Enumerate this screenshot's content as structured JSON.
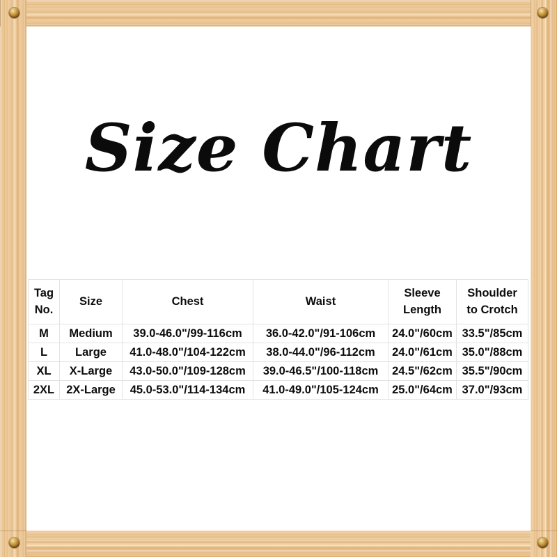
{
  "document": {
    "title": "Size Chart",
    "frame": {
      "material_name": "wooden-plank-frame",
      "wood_color": "#e9c18f",
      "wood_shadow_color": "#dcae76",
      "screw_color": "#d9ae52",
      "screw_name": "brass-screw"
    },
    "sheet_color": "#ffffff",
    "text_color": "#0c0c0c",
    "table_border_color": "#e3e3e3"
  },
  "size_table": {
    "headers": [
      {
        "line1": "Tag",
        "line2": "No."
      },
      {
        "line1": "Size",
        "line2": ""
      },
      {
        "line1": "Chest",
        "line2": ""
      },
      {
        "line1": "Waist",
        "line2": ""
      },
      {
        "line1": "Sleeve",
        "line2": "Length"
      },
      {
        "line1": "Shoulder",
        "line2": "to Crotch"
      }
    ],
    "rows": [
      {
        "tag_no": "M",
        "size": "Medium",
        "chest": "39.0-46.0\"/99-116cm",
        "waist": "36.0-42.0\"/91-106cm",
        "sleeve_length": "24.0\"/60cm",
        "shoulder_to_crotch": "33.5\"/85cm"
      },
      {
        "tag_no": "L",
        "size": "Large",
        "chest": "41.0-48.0\"/104-122cm",
        "waist": "38.0-44.0\"/96-112cm",
        "sleeve_length": "24.0\"/61cm",
        "shoulder_to_crotch": "35.0\"/88cm"
      },
      {
        "tag_no": "XL",
        "size": "X-Large",
        "chest": "43.0-50.0\"/109-128cm",
        "waist": "39.0-46.5\"/100-118cm",
        "sleeve_length": "24.5\"/62cm",
        "shoulder_to_crotch": "35.5\"/90cm"
      },
      {
        "tag_no": "2XL",
        "size": "2X-Large",
        "chest": "45.0-53.0\"/114-134cm",
        "waist": "41.0-49.0\"/105-124cm",
        "sleeve_length": "25.0\"/64cm",
        "shoulder_to_crotch": "37.0\"/93cm"
      }
    ]
  }
}
